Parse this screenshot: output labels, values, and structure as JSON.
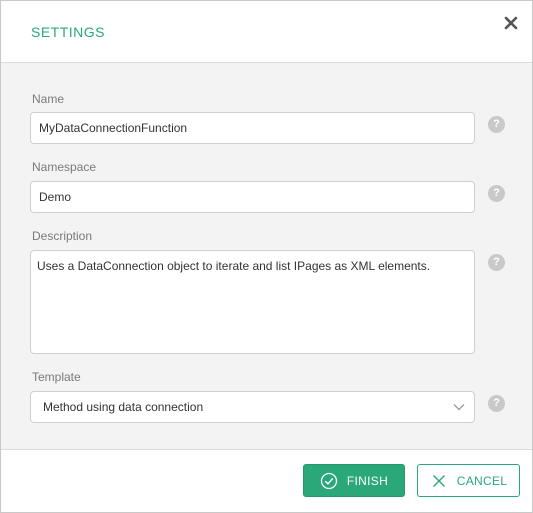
{
  "dialog": {
    "title": "SETTINGS",
    "close_icon": "close-icon"
  },
  "fields": {
    "name": {
      "label": "Name",
      "value": "MyDataConnectionFunction"
    },
    "namespace": {
      "label": "Namespace",
      "value": "Demo"
    },
    "description": {
      "label": "Description",
      "value": "Uses a DataConnection object to iterate and list IPages as XML elements."
    },
    "template": {
      "label": "Template",
      "value": "Method using data connection"
    }
  },
  "help_glyph": "?",
  "footer": {
    "finish_label": "FINISH",
    "cancel_label": "CANCEL"
  },
  "colors": {
    "accent": "#2aa87a",
    "body_bg": "#f3f3f3",
    "help_bg": "#c9c9c9"
  }
}
